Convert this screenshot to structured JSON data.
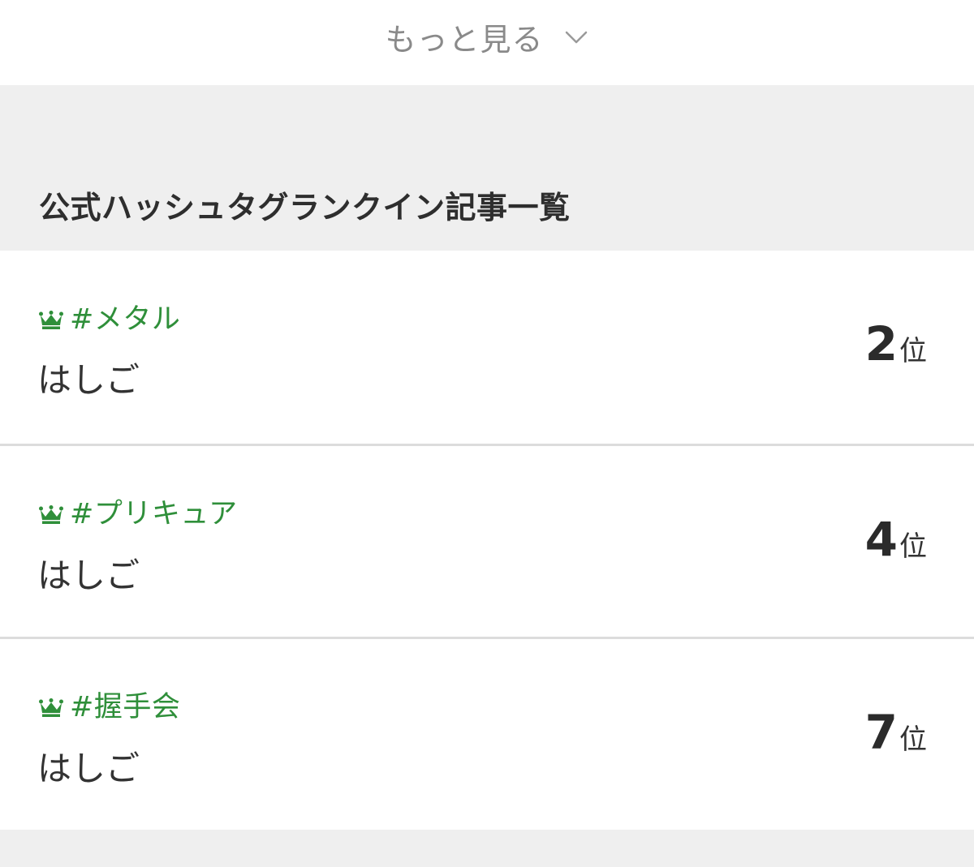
{
  "more": {
    "label": "もっと見る",
    "icon": "chevron-down-icon"
  },
  "section": {
    "title": "公式ハッシュタグランクイン記事一覧"
  },
  "colors": {
    "accent_green": "#2f8f3a",
    "background_gray": "#efefef",
    "divider": "#dcdcdc"
  },
  "items": [
    {
      "icon": "crown-icon",
      "tag": "#メタル",
      "title": "はしご",
      "rank": "2",
      "rank_suffix": "位"
    },
    {
      "icon": "crown-icon",
      "tag": "#プリキュア",
      "title": "はしご",
      "rank": "4",
      "rank_suffix": "位"
    },
    {
      "icon": "crown-icon",
      "tag": "#握手会",
      "title": "はしご",
      "rank": "7",
      "rank_suffix": "位"
    }
  ]
}
